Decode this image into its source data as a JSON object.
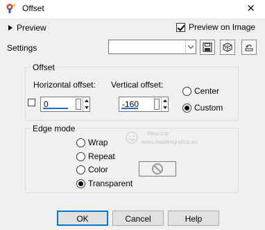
{
  "window": {
    "title": "Offset",
    "close_glyph": "✕"
  },
  "top": {
    "preview_label": "Preview",
    "preview_on_image_label": "Preview on Image",
    "preview_on_image_checked": true
  },
  "settings": {
    "label": "Settings",
    "value": ""
  },
  "offset": {
    "title": "Offset",
    "horizontal_label": "Horizontal offset:",
    "horizontal_value": "0",
    "vertical_label": "Vertical offset:",
    "vertical_value": "-160",
    "center_label": "Center",
    "custom_label": "Custom",
    "selected": "custom"
  },
  "edge_mode": {
    "title": "Edge mode",
    "options": [
      "Wrap",
      "Repeat",
      "Color",
      "Transparent"
    ],
    "selected": "Transparent"
  },
  "watermark": {
    "line1": "Pinuccia",
    "line2": "www.maidiregrafica.eu"
  },
  "buttons": {
    "ok": "OK",
    "cancel": "Cancel",
    "help": "Help"
  },
  "colors": {
    "accent": "#1c70d6",
    "focus_border": "#0078d7",
    "icon_red": "#e03b2a",
    "icon_blue": "#1f62c8"
  }
}
